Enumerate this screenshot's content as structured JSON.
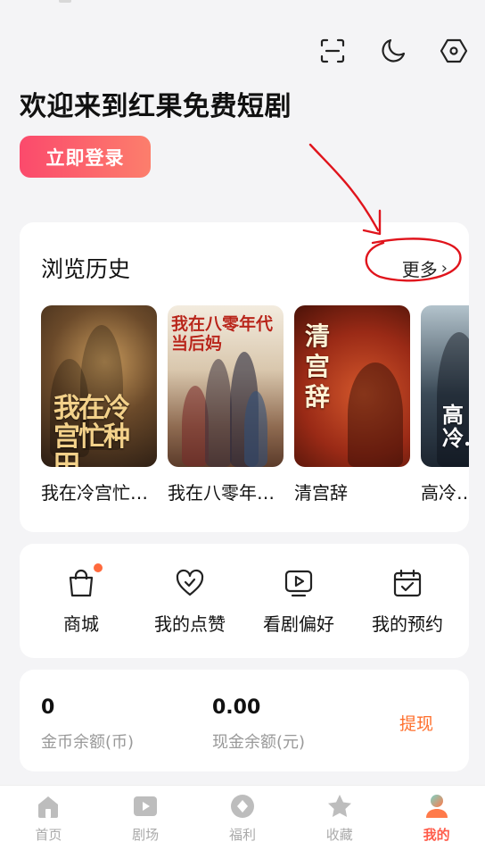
{
  "header": {
    "welcome": "欢迎来到红果免费短剧",
    "login_label": "立即登录",
    "icons": [
      "scan-icon",
      "moon-icon",
      "settings-icon"
    ]
  },
  "history": {
    "title": "浏览历史",
    "more_label": "更多",
    "items": [
      {
        "title": "我在冷宫忙…",
        "poster_text": "我在冷宫忙种田"
      },
      {
        "title": "我在八零年…",
        "poster_text": "我在八零年代当后妈"
      },
      {
        "title": "清宫辞",
        "poster_text": "清宫辞"
      },
      {
        "title": "高冷…",
        "poster_text": "高冷…"
      }
    ]
  },
  "shortcuts": [
    {
      "label": "商城",
      "icon": "shopping-bag-icon",
      "badge": true
    },
    {
      "label": "我的点赞",
      "icon": "heart-icon",
      "badge": false
    },
    {
      "label": "看剧偏好",
      "icon": "play-screen-icon",
      "badge": false
    },
    {
      "label": "我的预约",
      "icon": "calendar-check-icon",
      "badge": false
    }
  ],
  "wallet": {
    "coins_value": "0",
    "coins_label": "金币余额(币)",
    "cash_value": "0.00",
    "cash_label": "现金余额(元)",
    "withdraw_label": "提现"
  },
  "tabbar": {
    "items": [
      {
        "label": "首页",
        "icon": "home-icon",
        "active": false
      },
      {
        "label": "剧场",
        "icon": "theater-play-icon",
        "active": false
      },
      {
        "label": "福利",
        "icon": "coin-icon",
        "active": false
      },
      {
        "label": "收藏",
        "icon": "star-icon",
        "active": false
      },
      {
        "label": "我的",
        "icon": "profile-icon",
        "active": true
      }
    ]
  },
  "colors": {
    "accent": "#ff5b4a",
    "login_gradient_start": "#fb4a6c",
    "login_gradient_end": "#fc7e6c",
    "withdraw": "#ff6f2c",
    "annotation_red": "#e0141c"
  }
}
